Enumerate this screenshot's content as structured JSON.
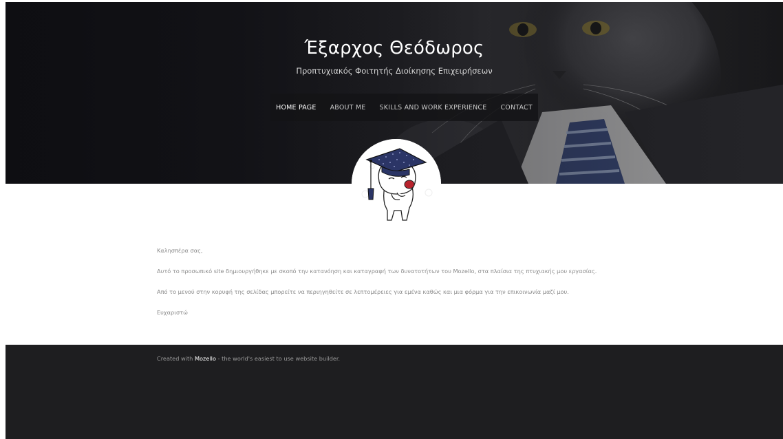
{
  "header": {
    "site_title": "Έξαρχος Θεόδωρος",
    "site_subtitle": "Προπτυχιακός Φοιτητής Διοίκησης Επιχειρήσεων"
  },
  "nav": {
    "items": [
      {
        "label": "HOME PAGE",
        "active": true
      },
      {
        "label": "ABOUT ME",
        "active": false
      },
      {
        "label": "SKILLS AND WORK EXPERIENCE",
        "active": false
      },
      {
        "label": "CONTACT",
        "active": false
      }
    ]
  },
  "main": {
    "paragraphs": [
      "Καλησπέρα σας,",
      "Αυτό το προσωπικό site δημιουργήθηκε με σκοπό την κατανόηση και καταγραφή των δυνατοτήτων του Mozello, στα πλαίσια της πτυχιακής μου εργασίας.",
      "Από το μενού στην κορυφή της σελίδας μπορείτε να περιηγηθείτε σε λεπτομέρειες για εμένα καθώς και μια φόρμα για την επικοινωνία μαζί μου.",
      "Ευχαριστώ"
    ]
  },
  "footer": {
    "prefix": "Created with ",
    "link_label": "Mozello",
    "suffix": " - the world's easiest to use website builder."
  },
  "icons": {
    "avatar": "graduate-cat-avatar",
    "hero_background": "cat-in-suit-photo"
  },
  "colors": {
    "hero_dark": "#121216",
    "nav_bg": "#141416",
    "footer_bg": "#1e1e20",
    "text_muted": "#8a8a8a"
  }
}
